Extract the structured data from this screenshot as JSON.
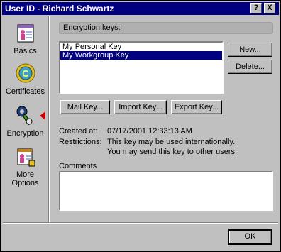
{
  "window": {
    "title": "User ID - Richard Schwartz"
  },
  "titlebar_buttons": {
    "help": "?",
    "close": "X"
  },
  "sidebar": {
    "items": [
      {
        "label": "Basics",
        "icon": "person-card-icon"
      },
      {
        "label": "Certificates",
        "icon": "certificate-seal-icon"
      },
      {
        "label": "Encryption",
        "icon": "key-icon",
        "selected": true
      },
      {
        "label": "More Options",
        "icon": "id-card-icon"
      }
    ]
  },
  "main": {
    "section_header": "Encryption keys:",
    "keys": [
      "My Personal Key",
      "My Workgroup Key"
    ],
    "selected_key": "My Workgroup Key",
    "buttons": {
      "new": "New...",
      "delete": "Delete...",
      "mail_key": "Mail Key...",
      "import_key": "Import Key...",
      "export_key": "Export Key..."
    },
    "created_label": "Created at:",
    "created_value": "07/17/2001 12:33:13 AM",
    "restrictions_label": "Restrictions:",
    "restrictions_line1": "This key may be used internationally.",
    "restrictions_line2": "You may send this key to other users.",
    "comments_label": "Comments",
    "comments_value": ""
  },
  "footer": {
    "ok": "OK"
  },
  "colors": {
    "title_bar": "#000080",
    "selection": "#000080",
    "face": "#c0c0c0",
    "indicator": "#cc0000"
  }
}
